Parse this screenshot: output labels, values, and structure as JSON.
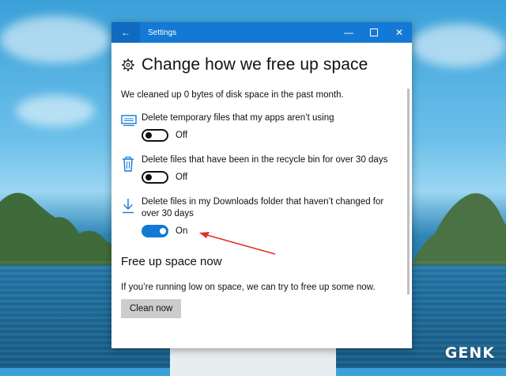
{
  "window": {
    "title": "Settings",
    "back_icon": "back-arrow-icon",
    "controls": [
      "minimize-icon",
      "maximize-icon",
      "close-icon"
    ]
  },
  "page": {
    "heading": "Change how we free up space",
    "heading_icon": "gear-icon",
    "summary": "We cleaned up 0 bytes of disk space in the past month."
  },
  "options": [
    {
      "icon": "storage-icon",
      "label": "Delete temporary files that my apps aren’t using",
      "state": "Off"
    },
    {
      "icon": "recycle-bin-icon",
      "label": "Delete files that have been in the recycle bin for over 30 days",
      "state": "Off"
    },
    {
      "icon": "download-icon",
      "label": "Delete files in my Downloads folder that haven’t changed for over 30 days",
      "state": "On"
    }
  ],
  "free_up": {
    "title": "Free up space now",
    "description": "If you’re running low on space, we can try to free up some now.",
    "button_label": "Clean now"
  },
  "watermark": "GENK",
  "colors": {
    "accent": "#1479d4",
    "annotation_arrow": "#e0302a"
  }
}
